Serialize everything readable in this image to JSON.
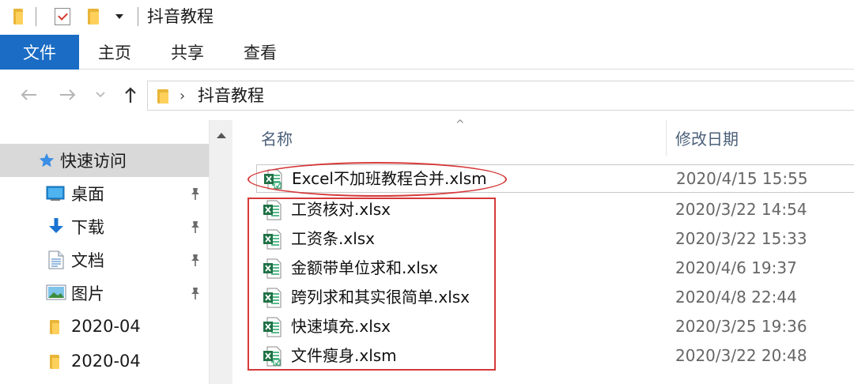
{
  "window": {
    "title": "抖音教程"
  },
  "ribbon": {
    "tabs": [
      "文件",
      "主页",
      "共享",
      "查看"
    ]
  },
  "address": {
    "path": "抖音教程"
  },
  "nav_pane": {
    "quick_access": "快速访问",
    "items": [
      {
        "label": "桌面",
        "icon": "desktop-icon",
        "pinned": true
      },
      {
        "label": "下载",
        "icon": "download-icon",
        "pinned": true
      },
      {
        "label": "文档",
        "icon": "document-icon",
        "pinned": true
      },
      {
        "label": "图片",
        "icon": "pictures-icon",
        "pinned": true
      },
      {
        "label": "2020-04",
        "icon": "folder-icon",
        "pinned": false
      },
      {
        "label": "2020-04",
        "icon": "folder-icon",
        "pinned": false
      }
    ]
  },
  "file_list": {
    "columns": {
      "name": "名称",
      "modified": "修改日期"
    },
    "files": [
      {
        "name": "Excel不加班教程合并.xlsm",
        "modified": "2020/4/15 15:55",
        "type": "xlsm"
      },
      {
        "name": "工资核对.xlsx",
        "modified": "2020/3/22 14:54",
        "type": "xlsx"
      },
      {
        "name": "工资条.xlsx",
        "modified": "2020/3/22 15:33",
        "type": "xlsx"
      },
      {
        "name": "金额带单位求和.xlsx",
        "modified": "2020/4/6 19:37",
        "type": "xlsx"
      },
      {
        "name": "跨列求和其实很简单.xlsx",
        "modified": "2020/4/8 22:44",
        "type": "xlsx"
      },
      {
        "name": "快速填充.xlsx",
        "modified": "2020/3/25 19:36",
        "type": "xlsx"
      },
      {
        "name": "文件瘦身.xlsm",
        "modified": "2020/3/22 20:48",
        "type": "xlsm"
      }
    ]
  },
  "colors": {
    "accent": "#1a6cc4",
    "annotation": "#d63a3a",
    "excel_green": "#1e7145"
  }
}
